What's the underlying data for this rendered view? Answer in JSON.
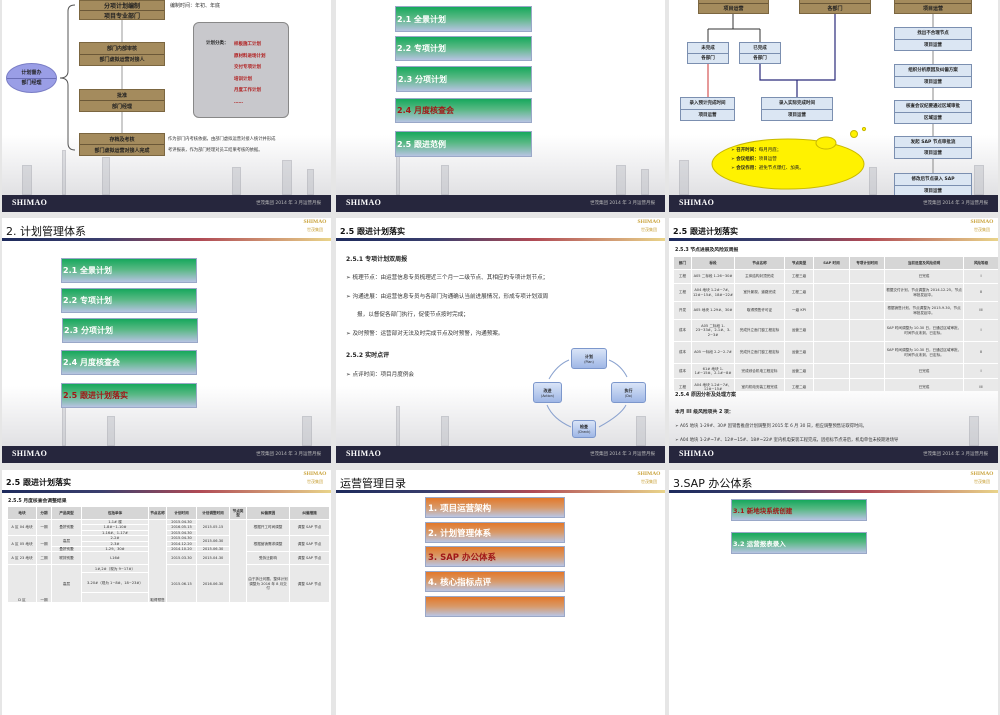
{
  "footer": {
    "logo": "SHIMAO",
    "text": "世茂集团 2014 年 3 月运营月报"
  },
  "header_logo": {
    "en": "SHIMAO",
    "cn": "世茂集团"
  },
  "slide1": {
    "oval": {
      "line1": "计划督办",
      "line2": "部门经理"
    },
    "boxes": [
      {
        "title": "分项计划编制",
        "sub": "项目专业部门"
      },
      {
        "title": "部门内部审核",
        "sub": "部门虚拟运营对接人"
      },
      {
        "title": "批准",
        "sub": "部门经理"
      },
      {
        "title": "存档及考核",
        "sub": "部门虚拟运营对接人完成"
      }
    ],
    "time_note": "编制时间：年初、年底",
    "scroll_label": "计划分类：",
    "scroll_items": [
      "样板施工计划",
      "原材料进场计划",
      "交付专项计划",
      "培训计划",
      "月度工作计划",
      "……"
    ],
    "bottom_note": [
      "作为部门内考核依据，由部门虚拟运营对接人统计并形成",
      "考评报表，作为部门经理对员工结果考核的依据。"
    ]
  },
  "slide2": {
    "items": [
      "2.1 全景计划",
      "2.2 专项计划",
      "2.3 分项计划",
      "2.4 月度核查会",
      "2.5 跟进范例"
    ]
  },
  "slide3": {
    "top_boxes": [
      "项目运营",
      "各部门",
      "项目运营"
    ],
    "undone": {
      "title": "未完成",
      "sub": "各部门"
    },
    "done": {
      "title": "已完成",
      "sub": "各部门"
    },
    "enter_planned": {
      "title": "录入预计完成时间",
      "sub": "项目运营"
    },
    "enter_actual": {
      "title": "录入实际完成时间",
      "sub": "项目运营"
    },
    "right_boxes": [
      {
        "title": "找出不合理节点",
        "sub": "项目运营"
      },
      {
        "title": "组织分析原因及纠偏方案",
        "sub": "项目运营"
      },
      {
        "title": "核查会议纪要通过区域审批",
        "sub": "区域运营"
      },
      {
        "title": "发起 SAP 节点审批流",
        "sub": "项目运营"
      },
      {
        "title": "修改后节点录入 SAP",
        "sub": "项目运营"
      }
    ],
    "cloud": [
      {
        "k": "召开时间：",
        "v": "每月月底；"
      },
      {
        "k": "会议组织：",
        "v": "项目运营"
      },
      {
        "k": "会议作用：",
        "v": "避免节点爆红、加黄。"
      }
    ]
  },
  "slide4": {
    "title": "2. 计划管理体系",
    "items": [
      "2.1 全景计划",
      "2.2 专项计划",
      "2.3 分项计划",
      "2.4 月度核查会",
      "2.5 跟进计划落实"
    ]
  },
  "slide5": {
    "title": "2.5 跟进计划落实",
    "h1": "2.5.1 专项计划双周报",
    "bullets": [
      "梳理节点：由运营信息专员梳理近三个月一二级节点、其相应的专项计划节点；",
      "沟通进展：由运营信息专员与各部门沟通确认当前进展情况，形成专项计划双周",
      "报，以督促各部门执行，促使节点按时完成；",
      "及时预警：运营部对无法及时完成节点及时预警，沟通预案。"
    ],
    "h2": "2.5.2 实时点评",
    "bullet2": "点评时间：项目月度例会",
    "pdca": {
      "plan": [
        "计划",
        "(Plan)"
      ],
      "do": [
        "执行",
        "(Do)"
      ],
      "check": [
        "检查",
        "(Check)"
      ],
      "act": [
        "改进",
        "(Action)"
      ]
    }
  },
  "slide6": {
    "title": "2.5 跟进计划落实",
    "subtitle": "2.5.3 节点进展及风险双周报",
    "headers": [
      "部门",
      "标段",
      "节点名称",
      "节点类型",
      "SAP 时间",
      "专项计划时间",
      "当前进度及风险说明",
      "风险等级"
    ],
    "rows": [
      [
        "工程",
        "A05 二标段 1-26~30#",
        "主体结构封顶完成",
        "工程三级",
        "",
        "",
        "已完成",
        "I"
      ],
      [
        "工程",
        "A04 地块 1-2#~7#、12#~15#、18#~22#",
        "室外景观、道路完成",
        "工程二级",
        "",
        "",
        "根据交付计划，节点调整为 2014.12.25，节点审批发起中。",
        "II"
      ],
      [
        "开发",
        "A05 地块 1-29#、30#",
        "取得预售许可证",
        "一级 KPI",
        "",
        "",
        "根据销售计划，节点调整为 2015.9.30，节点审批发起中。",
        "III"
      ],
      [
        "成本",
        "A05 二标段 1-23~33#、2-1#、3-2~3#",
        "完成外立面门窗工程定标",
        "运营三级",
        "",
        "",
        "SAP 时间调整为 10.30 日，已通过区域审批，时间节点未到，已定标。",
        "I"
      ],
      [
        "成本",
        "A05 一标段 2-2~2-7#",
        "完成外立面门窗工程定标",
        "运营三级",
        "",
        "",
        "SAP 时间调整为 10.30 日，已通过区域审批，时间节点未到，已定标。",
        "II"
      ],
      [
        "成本",
        "61# 地块 1-1#~15#、2-1#~8#",
        "完成综合机电工程定标",
        "运营二级",
        "",
        "",
        "已完成",
        "I"
      ],
      [
        "工程",
        "A04 地块 1-2#~7#、12#~15#",
        "室内机电安装工程完成",
        "工程二级",
        "",
        "",
        "已完成",
        "III"
      ]
    ],
    "h2": "2.5.4 原因分析及处理方案",
    "summary": "本月 III 级风险项共 2 项：",
    "bullets": [
      "A05 地块 1-29#、30# 因销售推盘计划调整到 2015 年 6 月 30 日，相应调整预售证取得时间。",
      "A04 地块 1-2#~7#、12#~15#、18#~22# 室内机电安装工程完成，因招标节点滞后，机电单位未按期进场导"
    ]
  },
  "slide7": {
    "title": "2.5 跟进计划落实",
    "subtitle": "2.5.5 月度核查会调整结果",
    "headers": [
      "地块",
      "分期",
      "产品类型",
      "包括单体",
      "节点名称",
      "计划时间",
      "计划调整时间",
      "节点类型",
      "纠偏原因",
      "纠偏措施"
    ],
    "a04": {
      "plot": "A 区 04 地块",
      "phase": "一期",
      "type": "叠拼别墅",
      "units": [
        "1-1# 楼",
        "1-8#~1-10#",
        "1-16#、1-17#"
      ],
      "plan": [
        "2015.04.30",
        "2016.05.15",
        "2015.04.30"
      ],
      "adj": "2015.05.15",
      "reason": "根据开工时间调整",
      "measure": "调整 SAP 节点"
    },
    "a05": {
      "plot": "A 区 05 地块",
      "phase": "一期",
      "type1": "高层",
      "type2": "叠拼别墅",
      "units": [
        "2-2#",
        "2-3#",
        "1-29、30#"
      ],
      "plan": [
        "2015.04.30",
        "2014.12.20",
        "2014.10.20"
      ],
      "adj": [
        "2015.06.30",
        "2015.06.30"
      ],
      "reason": "根据营销需求调整",
      "measure": "调整 SAP 节点"
    },
    "a23": {
      "plot": "A 区 23 地块",
      "phase": "二期",
      "type": "联排别墅",
      "units": "L16#",
      "plan": "2015.03.30",
      "adj": "2015.04.30",
      "reason": "受拆迁影响",
      "measure": "调整 SAP 节点"
    },
    "d": {
      "plot": "D 区",
      "phase": "一期",
      "type": "高层",
      "units": [
        "1#,2#（现为 9~17#）",
        "3-20#（现为 1~8#、18~23#）"
      ],
      "node": "取得预售",
      "plan": "2015.06.15",
      "adj": "2016.06.30",
      "reason": "由于拆迁问题，整体计划调整为 2016 年 8 月交付",
      "measure": "调整 SAP 节点"
    }
  },
  "slide8": {
    "title": "运营管理目录",
    "items": [
      "1. 项目运营架构",
      "2. 计划管理体系",
      "3. SAP 办公体系",
      "4. 核心指标点评",
      ""
    ]
  },
  "slide9": {
    "title": "3.SAP 办公体系",
    "items": [
      "3.1 新地块系统创建",
      "3.2 运营报表录入"
    ]
  }
}
